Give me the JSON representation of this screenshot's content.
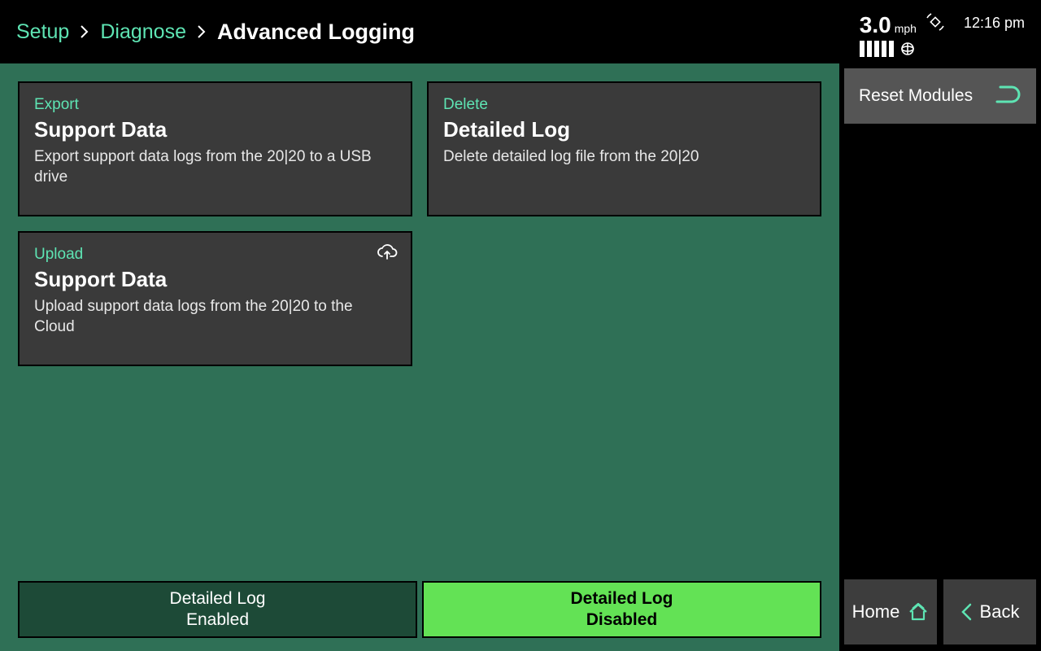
{
  "breadcrumb": {
    "setup": "Setup",
    "diagnose": "Diagnose",
    "current": "Advanced Logging"
  },
  "status": {
    "speed": "3.0",
    "speed_unit": "mph",
    "time": "12:16 pm"
  },
  "cards": {
    "export": {
      "kicker": "Export",
      "title": "Support Data",
      "desc": "Export support data logs from the 20|20 to a USB drive"
    },
    "delete": {
      "kicker": "Delete",
      "title": "Detailed Log",
      "desc": "Delete detailed log file from the 20|20"
    },
    "upload": {
      "kicker": "Upload",
      "title": "Support Data",
      "desc": "Upload support data logs from the 20|20 to the Cloud"
    }
  },
  "toggle": {
    "enabled_l1": "Detailed Log",
    "enabled_l2": "Enabled",
    "disabled_l1": "Detailed Log",
    "disabled_l2": "Disabled"
  },
  "sidebar": {
    "reset": "Reset Modules",
    "home": "Home",
    "back": "Back"
  }
}
